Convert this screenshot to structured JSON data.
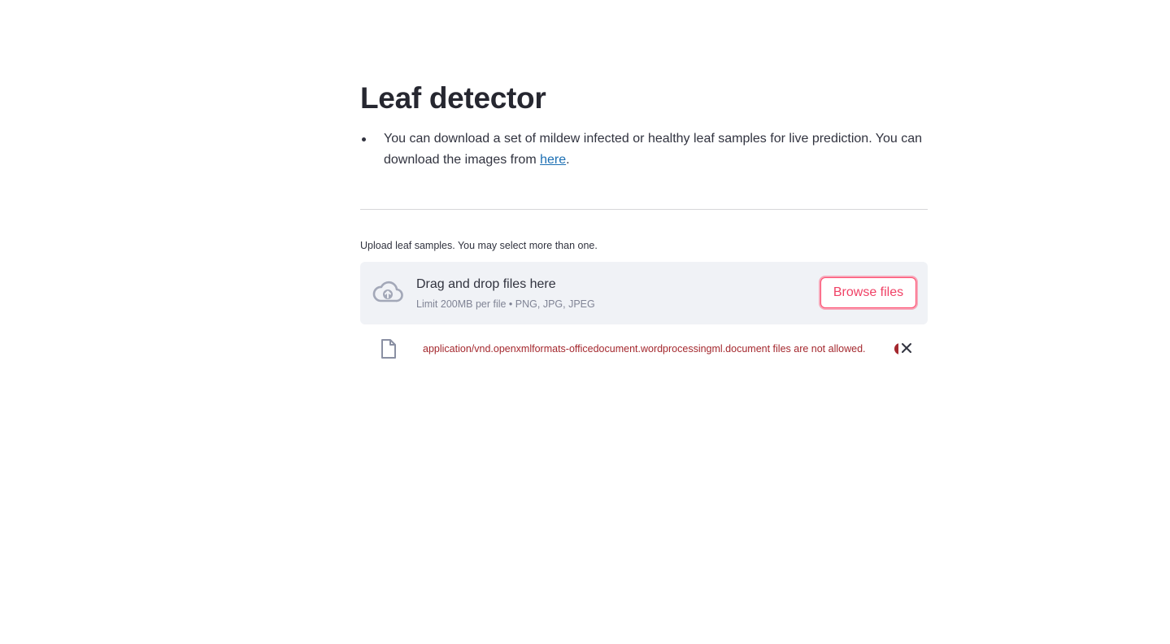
{
  "page": {
    "title": "Leaf detector",
    "intro": {
      "text": "You can download a set of mildew infected or healthy leaf samples for live prediction. You can download the images from ",
      "link_label": "here",
      "suffix": "."
    }
  },
  "uploader": {
    "label": "Upload leaf samples. You may select more than one.",
    "drop_text": "Drag and drop files here",
    "limit_text": "Limit 200MB per file • PNG, JPG, JPEG",
    "browse_label": "Browse files",
    "upload_icon": "cloud-upload-icon",
    "file": {
      "icon": "file-icon",
      "error": "application/vnd.openxmlformats-officedocument.wordprocessingml.document files are not allowed.",
      "remove_icon": "close-icon"
    }
  },
  "colors": {
    "accent": "#ff4b6e",
    "error": "#a4282e",
    "link": "#1c6fb3",
    "dropzone_bg": "#f0f2f6"
  }
}
